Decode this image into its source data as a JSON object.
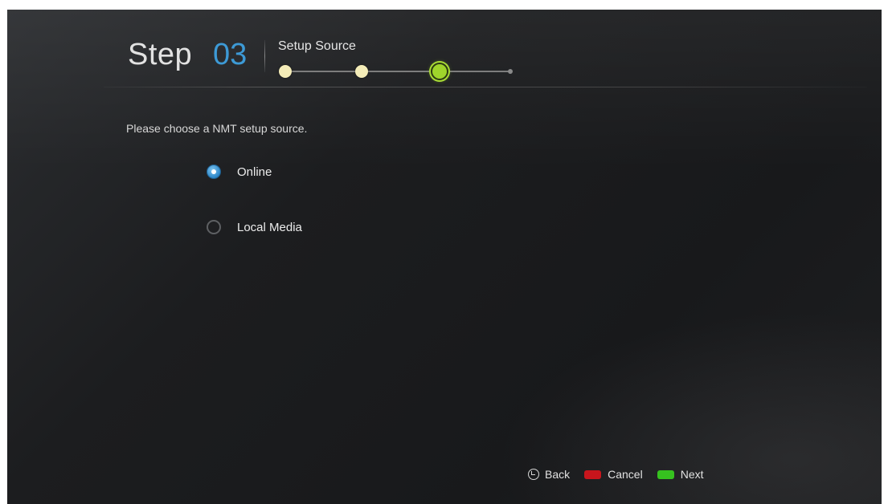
{
  "header": {
    "step_word": "Step",
    "step_number": "03",
    "title": "Setup Source",
    "progress": {
      "total_steps": 4,
      "current_step": 3
    }
  },
  "main": {
    "instruction": "Please choose a NMT setup source.",
    "options": [
      {
        "label": "Online",
        "selected": true
      },
      {
        "label": "Local Media",
        "selected": false
      }
    ]
  },
  "footer": {
    "back_label": "Back",
    "back_icon": "back-icon",
    "cancel_label": "Cancel",
    "cancel_color": "#c8151c",
    "next_label": "Next",
    "next_color": "#36c21f"
  },
  "colors": {
    "accent_blue": "#3d9ad6",
    "progress_done": "#f4ecb8",
    "progress_current": "#9fd42b"
  }
}
